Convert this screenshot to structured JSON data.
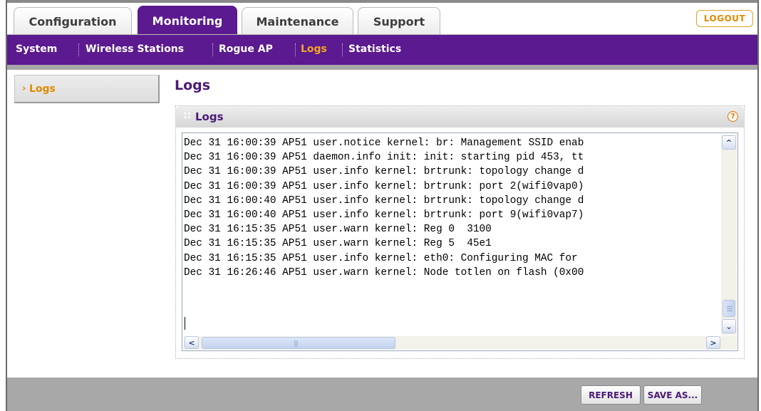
{
  "tabs": [
    {
      "label": "Configuration",
      "active": false
    },
    {
      "label": "Monitoring",
      "active": true
    },
    {
      "label": "Maintenance",
      "active": false
    },
    {
      "label": "Support",
      "active": false
    }
  ],
  "logout_label": "LOGOUT",
  "subnav": {
    "items": [
      {
        "label": "System",
        "active": false
      },
      {
        "label": "Wireless Stations",
        "active": false
      },
      {
        "label": "Rogue AP",
        "active": false
      },
      {
        "label": "Logs",
        "active": true
      },
      {
        "label": "Statistics",
        "active": false
      }
    ]
  },
  "sidebar": {
    "items": [
      {
        "label": "Logs",
        "active": true
      }
    ]
  },
  "main": {
    "title": "Logs",
    "panel_title": "Logs",
    "log_lines": [
      "Dec 31 16:00:39 AP51 user.notice kernel: br: Management SSID enab",
      "Dec 31 16:00:39 AP51 daemon.info init: init: starting pid 453, tt",
      "Dec 31 16:00:39 AP51 user.info kernel: brtrunk: topology change d",
      "Dec 31 16:00:39 AP51 user.info kernel: brtrunk: port 2(wifi0vap0)",
      "Dec 31 16:00:40 AP51 user.info kernel: brtrunk: topology change d",
      "Dec 31 16:00:40 AP51 user.info kernel: brtrunk: port 9(wifi0vap7)",
      "Dec 31 16:15:35 AP51 user.warn kernel: Reg 0  3100",
      "Dec 31 16:15:35 AP51 user.warn kernel: Reg 5  45e1",
      "Dec 31 16:15:35 AP51 user.info kernel: eth0: Configuring MAC for",
      "Dec 31 16:26:46 AP51 user.warn kernel: Node totlen on flash (0x00"
    ]
  },
  "actions": {
    "refresh_label": "REFRESH",
    "save_as_label": "SAVE AS..."
  },
  "colors": {
    "brand_purple": "#5b1a8f",
    "accent_orange": "#f5a623"
  },
  "icons": {
    "help": "help-icon",
    "sidebar_arrow": "chevron-right-icon",
    "scroll_up": "chevron-up-icon",
    "scroll_down": "chevron-down-icon",
    "scroll_left": "chevron-left-icon",
    "scroll_right": "chevron-right-icon"
  }
}
